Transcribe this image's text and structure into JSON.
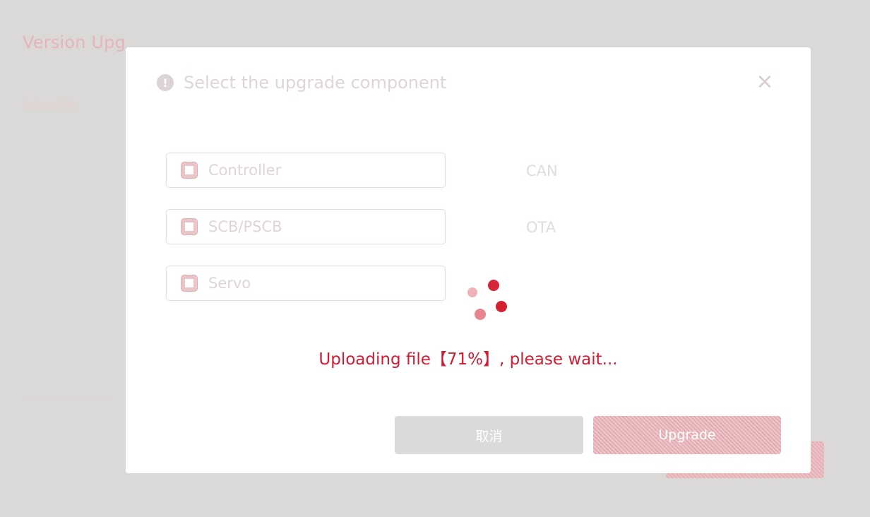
{
  "background_page": {
    "title": "Version Upg",
    "subtitle": "Select File"
  },
  "dialog": {
    "title": "Select the upgrade component",
    "info_icon": "!",
    "close_icon": "×",
    "options": [
      {
        "label": "Controller",
        "checked": false
      },
      {
        "label": "SCB/PSCB",
        "checked": false
      },
      {
        "label": "Servo",
        "checked": false
      }
    ],
    "side_labels": [
      "CAN",
      "OTA"
    ],
    "status_text": "Uploading file【71%】, please wait...",
    "progress_percent": 71,
    "buttons": {
      "cancel": "取消",
      "upgrade": "Upgrade"
    }
  },
  "colors": {
    "accent": "#d41b30",
    "overlay_bg": "#dbd8d8",
    "dialog_bg": "#ffffff"
  },
  "icons": [
    "info-icon",
    "close-icon",
    "checkbox-icon",
    "loading-spinner"
  ]
}
